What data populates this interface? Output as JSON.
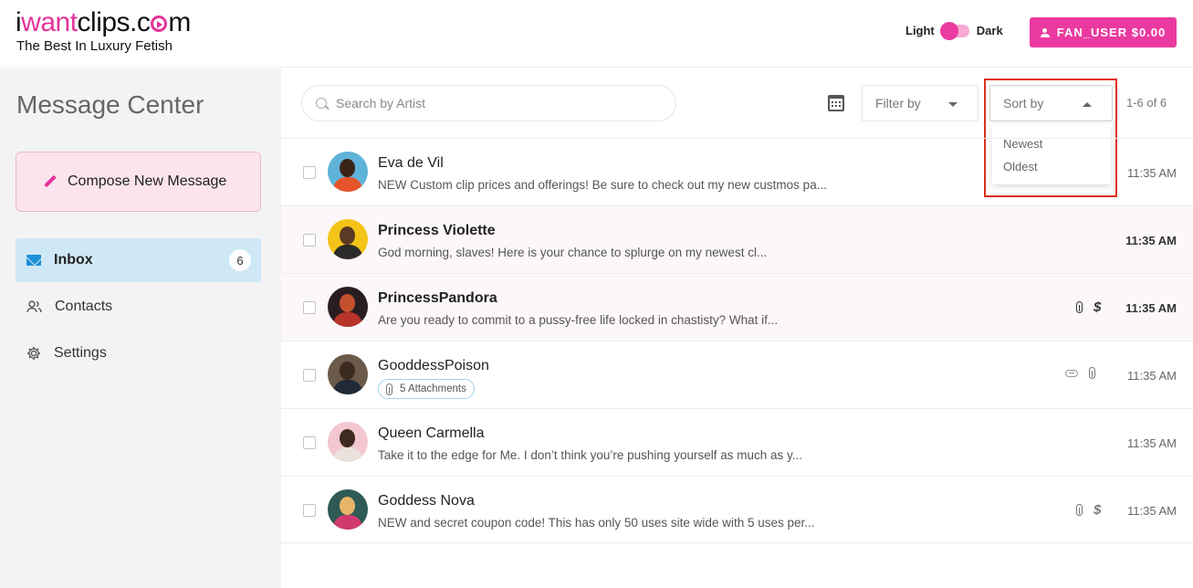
{
  "header": {
    "logo": {
      "part1": "i",
      "part2": "want",
      "part3": "clips.c",
      "part4": "m"
    },
    "tagline": "The Best In Luxury Fetish",
    "theme_light": "Light",
    "theme_dark": "Dark",
    "user_button": "FAN_USER $0.00"
  },
  "sidebar": {
    "title": "Message Center",
    "compose_label": "Compose New Message",
    "items": [
      {
        "label": "Inbox",
        "badge": "6"
      },
      {
        "label": "Contacts"
      },
      {
        "label": "Settings"
      }
    ]
  },
  "toolbar": {
    "search_placeholder": "Search by Artist",
    "filter_label": "Filter by",
    "sort_label": "Sort by",
    "sort_options": [
      "Newest",
      "Oldest"
    ],
    "pager": "1-6 of 6"
  },
  "messages": [
    {
      "name": "Eva de Vil",
      "preview": "NEW Custom clip prices and offerings! Be sure to check out my new custmos pa...",
      "time": "11:35 AM",
      "unread": false
    },
    {
      "name": "Princess Violette",
      "preview": "God morning, slaves! Here is your chance to splurge on my newest cl...",
      "time": "11:35 AM",
      "unread": true
    },
    {
      "name": "PrincessPandora",
      "preview": "Are you ready to commit to a pussy-free life locked in chastisty? What if...",
      "time": "11:35 AM",
      "unread": true
    },
    {
      "name": "GooddessPoison",
      "attachments": "5 Attachments",
      "time": "11:35 AM",
      "unread": false
    },
    {
      "name": "Queen Carmella",
      "preview": "Take it to the edge for Me. I don’t think you’re pushing yourself as much as y...",
      "time": "11:35 AM",
      "unread": false
    },
    {
      "name": "Goddess Nova",
      "preview": "NEW and secret coupon code! This has only 50 uses site wide with 5 uses per...",
      "time": "11:35 AM",
      "unread": false
    }
  ],
  "colors": {
    "brand_pink": "#ea3aa0",
    "inbox_active_bg": "#cfe8f5",
    "highlight_box": "#e0301e"
  },
  "icons": [
    "user-icon",
    "pencil-icon",
    "mail-icon",
    "contacts-icon",
    "gear-icon",
    "search-icon",
    "calendar-icon",
    "paperclip-icon",
    "dollar-icon",
    "link-icon"
  ]
}
